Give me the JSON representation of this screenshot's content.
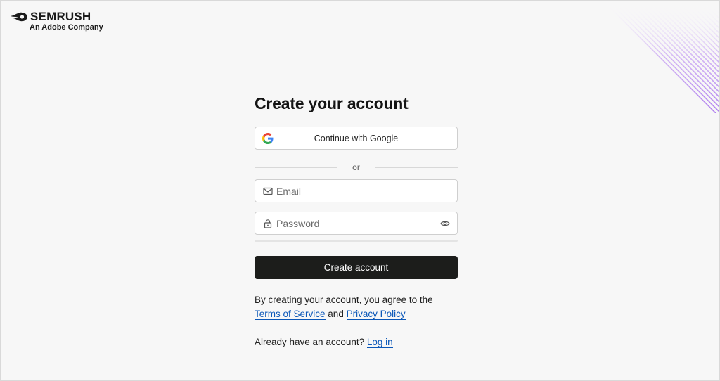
{
  "brand": {
    "name": "SEMRUSH",
    "tagline": "An Adobe Company",
    "accent": "#b98cf0"
  },
  "form": {
    "title": "Create your account",
    "google_label": "Continue with Google",
    "divider_text": "or",
    "email_placeholder": "Email",
    "password_placeholder": "Password",
    "submit_label": "Create account",
    "primary_color": "#1c1d1b"
  },
  "terms": {
    "prefix": "By creating your account, you agree to the",
    "tos_label": "Terms of Service",
    "and": "and",
    "privacy_label": "Privacy Policy"
  },
  "login": {
    "prompt": "Already have an account?",
    "link_label": "Log in"
  },
  "icons": {
    "logo": "semrush-fireball-icon",
    "google": "google-icon",
    "email": "mail-icon",
    "password": "lock-icon",
    "toggle": "eye-icon"
  },
  "link_color": "#0b57b8"
}
